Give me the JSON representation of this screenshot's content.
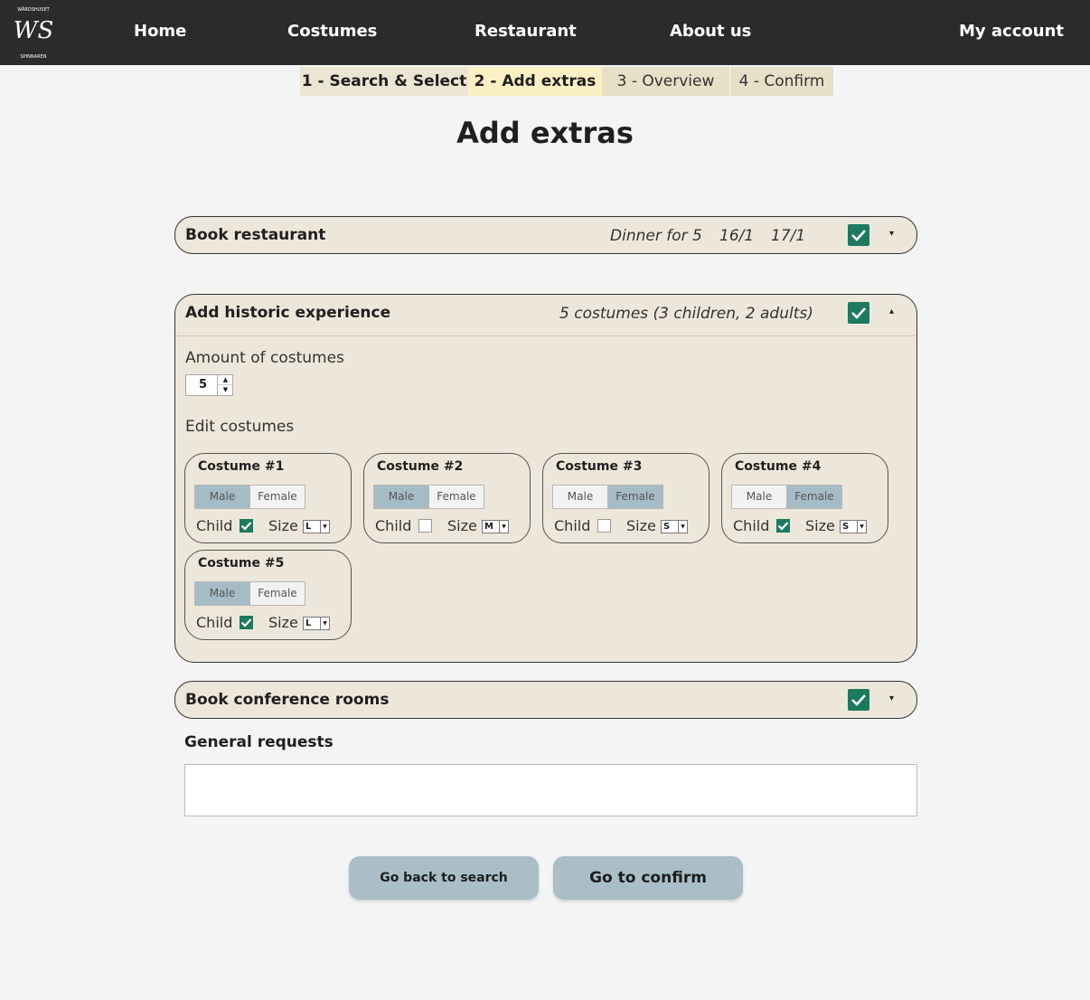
{
  "nav": {
    "logo": {
      "letters": "WS",
      "top_text": "WÄRDSHUSET",
      "bottom_text": "SPINNAREN"
    },
    "links": [
      "Home",
      "Costumes",
      "Restaurant",
      "About us"
    ],
    "account": "My account"
  },
  "steps": [
    {
      "label": "1 - Search & Select",
      "state": "done"
    },
    {
      "label": "2 - Add extras",
      "state": "active"
    },
    {
      "label": "3 - Overview",
      "state": "todo"
    },
    {
      "label": "4 - Confirm",
      "state": "todo"
    }
  ],
  "page_title": "Add extras",
  "restaurant": {
    "title": "Book restaurant",
    "summary": "Dinner for 5",
    "date1": "16/1",
    "date2": "17/1",
    "checked": true,
    "caret": "▾"
  },
  "historic": {
    "title": "Add historic experience",
    "summary": "5 costumes (3 children, 2 adults)",
    "checked": true,
    "caret": "▴",
    "amount_label": "Amount of costumes",
    "amount_value": "5",
    "edit_label": "Edit costumes",
    "male_label": "Male",
    "female_label": "Female",
    "child_label": "Child",
    "size_label": "Size",
    "costumes": [
      {
        "title": "Costume #1",
        "gender": "Male",
        "child": true,
        "size": "L"
      },
      {
        "title": "Costume #2",
        "gender": "Male",
        "child": false,
        "size": "M"
      },
      {
        "title": "Costume #3",
        "gender": "Female",
        "child": false,
        "size": "S"
      },
      {
        "title": "Costume #4",
        "gender": "Female",
        "child": true,
        "size": "S"
      },
      {
        "title": "Costume #5",
        "gender": "Male",
        "child": true,
        "size": "L"
      }
    ]
  },
  "conference": {
    "title": "Book conference rooms",
    "checked": true,
    "caret": "▾"
  },
  "general_requests": {
    "label": "General requests",
    "value": ""
  },
  "buttons": {
    "back": "Go back to search",
    "confirm": "Go to confirm"
  },
  "colors": {
    "nav_bg": "#2b2b2b",
    "panel_bg": "#ede7db",
    "check_green": "#1c7a5f",
    "button_bg": "#a9bec7",
    "selected_segment": "#a5bcc6",
    "active_step": "#fbf0c4"
  }
}
